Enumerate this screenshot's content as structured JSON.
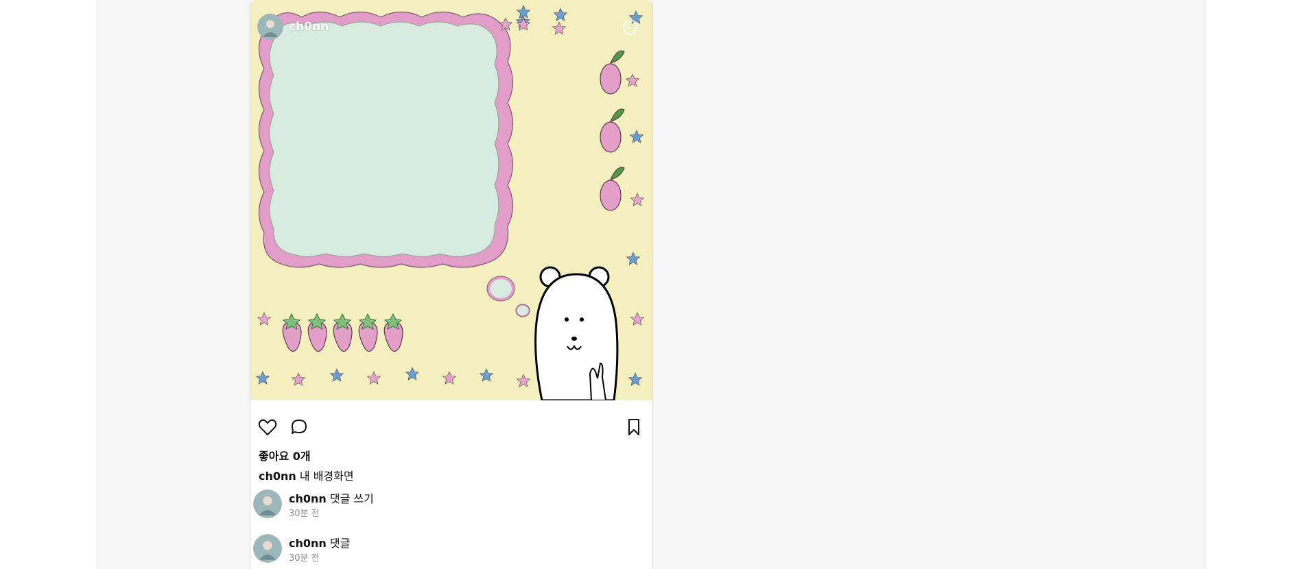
{
  "post": {
    "author": "ch0nn",
    "likes_text": "좋아요 0개",
    "caption": {
      "username": "ch0nn",
      "text": "내 배경화면"
    },
    "comments": [
      {
        "username": "ch0nn",
        "text": "댓글 쓰기",
        "time": "30분 전"
      },
      {
        "username": "ch0nn",
        "text": "댓글",
        "time": "30분 전"
      }
    ]
  },
  "colors": {
    "page_bg": "#f5f5f5",
    "image_bg": "#f4efbf",
    "cloud_fill": "#d7ebde",
    "cloud_border": "#e29ec9",
    "star_blue": "#6a9fd4",
    "star_pink": "#e6a3c9",
    "fruit_pink": "#e39fc8"
  },
  "icons": [
    "heart-icon",
    "comment-icon",
    "bookmark-icon",
    "more-icon"
  ]
}
